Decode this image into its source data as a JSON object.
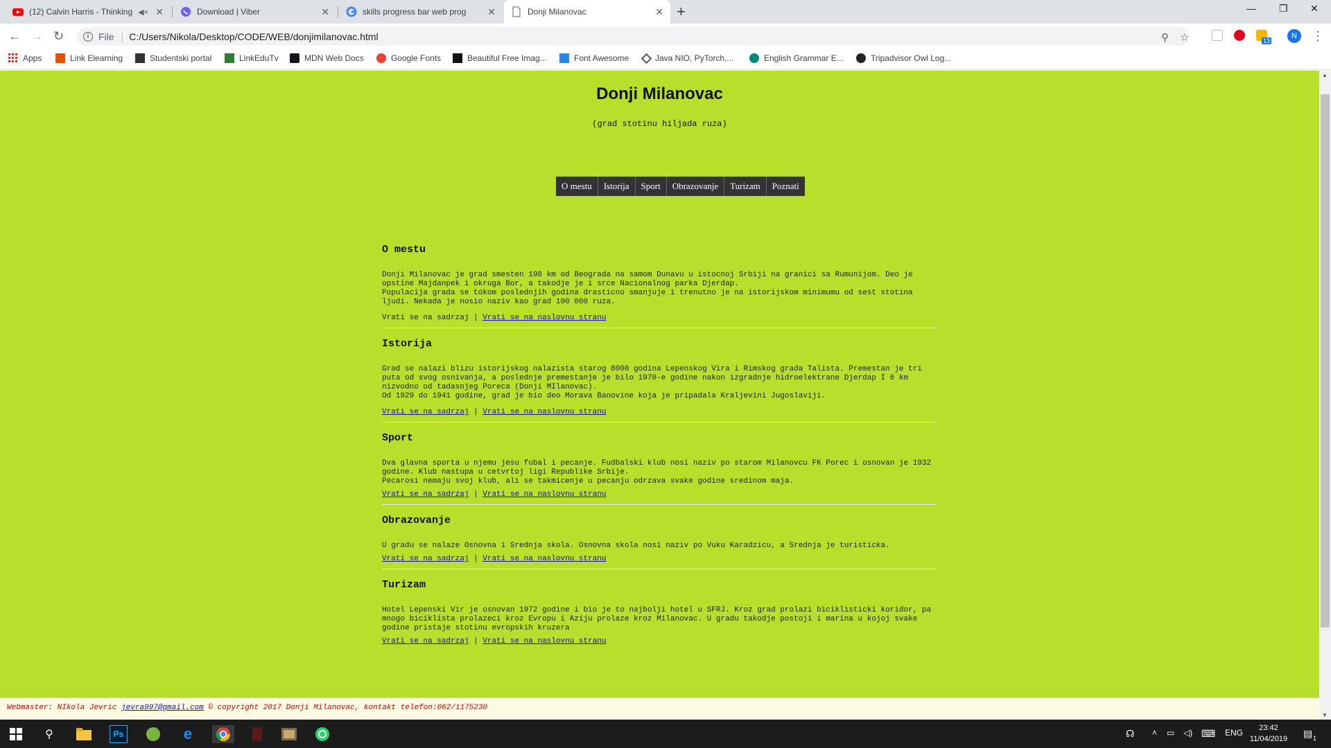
{
  "browser": {
    "tabs": [
      {
        "label": "(12) Calvin Harris - Thinking",
        "icon": "youtube-icon"
      },
      {
        "label": "Download | Viber",
        "icon": "viber-icon"
      },
      {
        "label": "skills progress bar web programm",
        "icon": "google-icon"
      },
      {
        "label": "Donji Milanovac",
        "icon": "document-icon"
      }
    ],
    "active_tab": 3,
    "address": {
      "scheme": "File",
      "url": "C:/Users/Nikola/Desktop/CODE/WEB/donjimilanovac.html"
    },
    "profile_initial": "N",
    "ext_badge": "13",
    "bookmarks": [
      {
        "label": "Apps"
      },
      {
        "label": "Link Elearning"
      },
      {
        "label": "Studentski portal"
      },
      {
        "label": "LinkEduTv"
      },
      {
        "label": "MDN Web Docs"
      },
      {
        "label": "Google Fonts"
      },
      {
        "label": "Beautiful Free Imag..."
      },
      {
        "label": "Font Awesome"
      },
      {
        "label": "Java NIO, PyTorch,..."
      },
      {
        "label": "English Grammar E..."
      },
      {
        "label": "Tripadvisor Owl Log..."
      }
    ]
  },
  "page": {
    "title": "Donji Milanovac",
    "subtitle": "(grad stotinu hiljada ruza)",
    "nav": [
      "O mestu",
      "Istorija",
      "Sport",
      "Obrazovanje",
      "Turizam",
      "Poznati"
    ],
    "back_to_contents": "Vrati se na sadrzaj",
    "back_to_home": "Vrati se na naslovnu stranu",
    "link_sep": "|",
    "sections": [
      {
        "heading": "O mestu",
        "paragraphs": [
          "Donji Milanovac je grad smesten 198 km od Beograda na samom Dunavu u istocnoj Srbiji na granici sa Rumunijom. Deo je opstine Majdanpek i okruga Bor, a takodje je i srce Nacionalnog parka Djerdap.",
          "Populacija grada se tokom poslednjih godina drasticno smanjuje i trenutno je na istorijskom minimumu od sest stotina ljudi. Nekada je nosio naziv kao grad 100 000 ruza."
        ]
      },
      {
        "heading": "Istorija",
        "paragraphs": [
          "Grad se nalazi blizu istorijskog nalazista starog 8000 godina Lepenskog Vira i Rimskog grada Talista. Premestan je tri puta od svog osnivanja, a poslednje premestanje je bilo 1970-e godine nakon izgradnje hidroelektrane Djerdap I 6 km nizvodno od tadasnjeg Poreca (Donji MIlanovac).",
          "Od 1929 do 1941 godine, grad je bio deo Morava Banovine koja je pripadala Kraljevini Jugoslaviji."
        ]
      },
      {
        "heading": "Sport",
        "paragraphs": [
          "Dva glavna sporta u njemu jesu fubal i pecanje. Fudbalski klub nosi naziv po starom Milanovcu FK Porec i osnovan je 1932 godine. Klub nastupa u cetvrtoj ligi Republike Srbije.",
          "Pecarosi nemaju svoj klub, ali se takmicenje u pecanju odrzava svake godine sredinom maja."
        ]
      },
      {
        "heading": "Obrazovanje",
        "paragraphs": [
          "U gradu se nalaze Osnovna i Srednja skola. Osnovna skola nosi naziv po Vuku Karadzicu, a Srednja je turisticka."
        ]
      },
      {
        "heading": "Turizam",
        "paragraphs": [
          "Hotel Lepenski Vir je osnovan 1972 godine i bio je to najbolji hotel u SFRJ. Kroz grad prolazi biciklisticki koridor, pa mnogo biciklista prolazeci kroz Evropu i Aziju prolaze kroz Milanovac. U gradu takodje postoji i marina u kojoj svake godine pristaje stotinu evropskih kruzera"
        ]
      }
    ],
    "footer": {
      "prefix": "Webmaster: NIkola Jevric ",
      "email": "jevra997@gmail.com",
      "suffix": " © copyright 2017 Donji Milanovac, kontakt telefon:062/1175230"
    }
  },
  "taskbar": {
    "language": "ENG",
    "time": "23:42",
    "date": "11/04/2019",
    "notification_count": "1"
  }
}
